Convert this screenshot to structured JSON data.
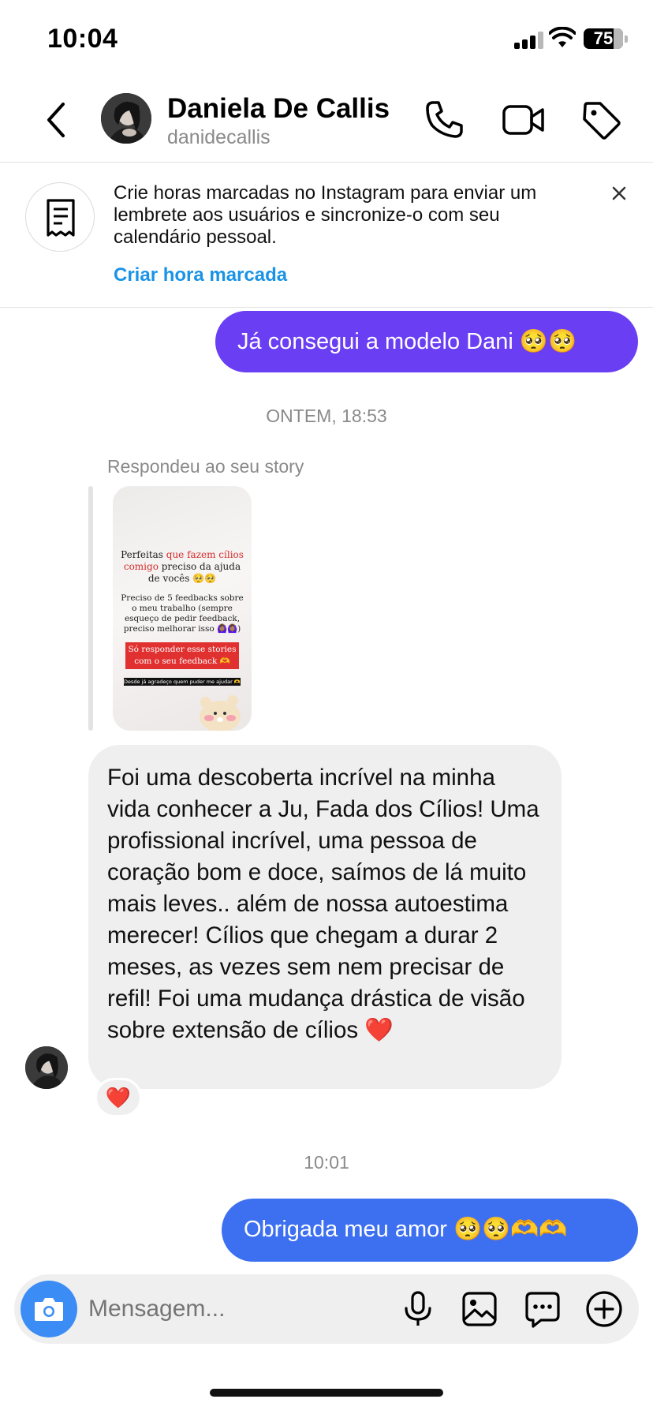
{
  "status_bar": {
    "time": "10:04",
    "battery": "75"
  },
  "header": {
    "contact_name": "Daniela De Callis",
    "contact_username": "danidecallis",
    "icons": [
      "back-icon",
      "phone-icon",
      "video-icon",
      "tag-icon"
    ]
  },
  "banner": {
    "text": "Crie horas marcadas no Instagram para enviar um lembrete aos usuários e sincronize-o com seu calendário pessoal.",
    "link": "Criar hora marcada",
    "icon": "receipt-icon"
  },
  "messages": {
    "out_1": "Já consegui a modelo Dani 🥺🥺",
    "timestamp_1": "ONTEM, 18:53",
    "story_caption": "Respondeu ao seu story",
    "story": {
      "line1_a": "Perfeitas ",
      "line1_red": "que fazem cílios comigo",
      "line1_b": " preciso da ajuda de vocês 🥺🥺",
      "line2": "Preciso de 5 feedbacks sobre o meu trabalho (sempre esqueço de pedir feedback, preciso melhorar isso 🙆🏽‍♀️🙆🏽‍♀️)",
      "red_box": "Só responder esse stories com o seu feedback 🫶",
      "black_bar": "Desde já agradeço quem puder me ajudar 🫶"
    },
    "in_1": "Foi uma descoberta incrível na minha vida conhecer a Ju, Fada dos Cílios! Uma profissional incrível, uma pessoa de coração bom e doce, saímos de lá muito mais leves.. além de nossa autoestima merecer! Cílios que chegam a durar 2 meses, as vezes sem nem precisar de refil! Foi uma mudança drástica de visão sobre extensão de cílios ",
    "in_1_heart": "❤️",
    "reaction": "❤️",
    "timestamp_2": "10:01",
    "out_2": "Obrigada meu amor 🥺🥺🫶🫶"
  },
  "composer": {
    "placeholder": "Mensagem...",
    "icons": [
      "camera-icon",
      "microphone-icon",
      "gallery-icon",
      "sticker-chat-icon",
      "add-icon"
    ]
  },
  "colors": {
    "out_bubble_purple": "#6a3ef2",
    "out_bubble_blue": "#3d6ff1",
    "link_blue": "#1a93e6",
    "camera_blue": "#3b8df5",
    "in_bubble": "#efefef"
  }
}
